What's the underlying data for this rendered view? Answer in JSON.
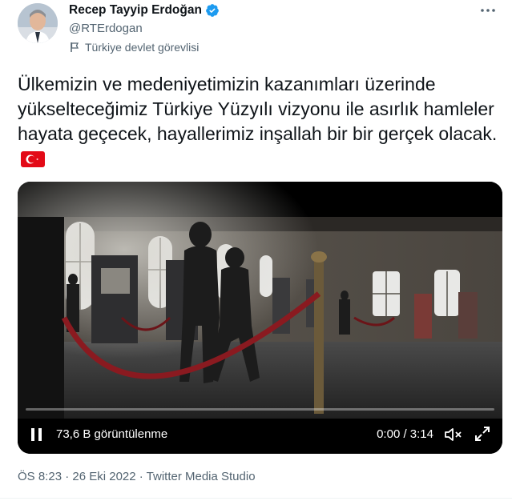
{
  "author": {
    "name": "Recep Tayyip Erdoğan",
    "handle": "@RTErdogan",
    "verified_icon": "verified-badge-icon",
    "label": "Türkiye devlet görevlisi"
  },
  "tweet": {
    "text": "Ülkemizin ve medeniyetimizin kazanımları üzerinde yükselteceğimiz Türkiye Yüzyılı vizyonu ile asırlık hamleler hayata geçecek, hayallerimiz inşallah bir bir gerçek olacak."
  },
  "video": {
    "views": "73,6 B görüntülenme",
    "time": "0:00 / 3:14"
  },
  "meta": {
    "timestamp": "ÖS 8:23 · 26 Eki 2022 · Twitter Media Studio"
  },
  "colors": {
    "accent": "#1d9bf0",
    "text": "#0f1419",
    "secondary": "#536471",
    "flag_red": "#e30a17"
  }
}
